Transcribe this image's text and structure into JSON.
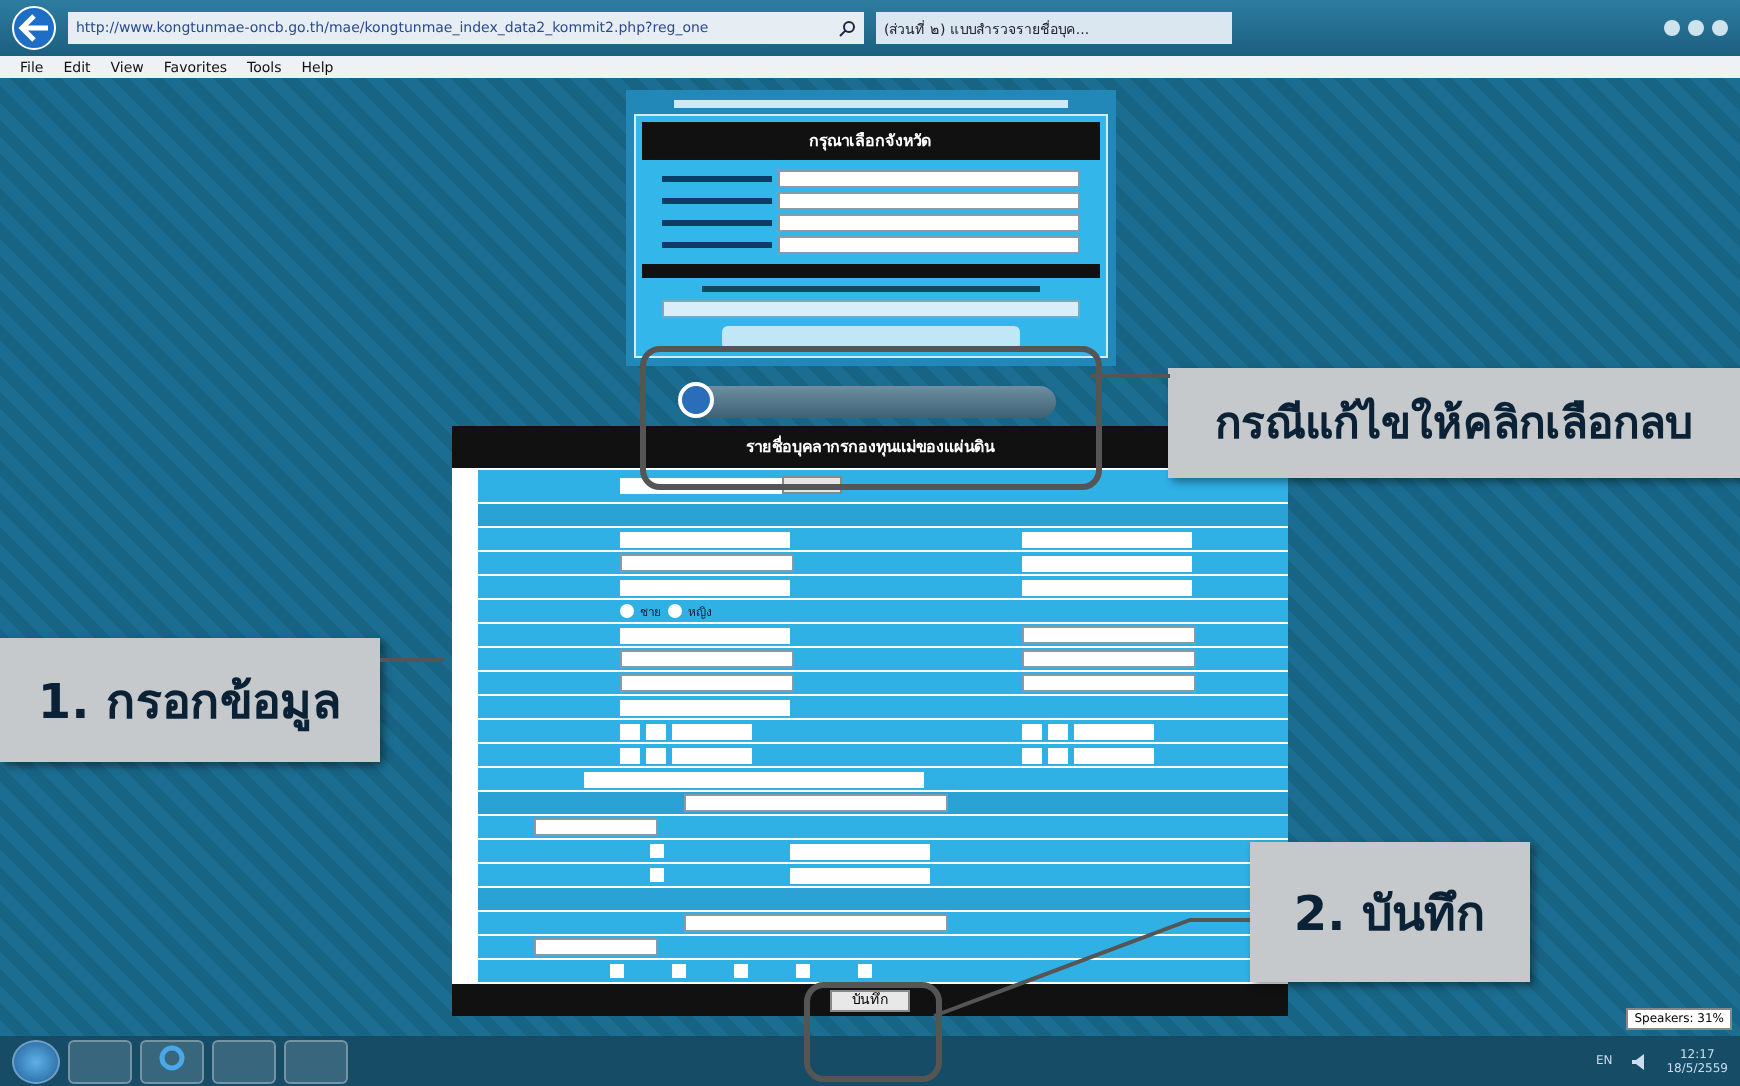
{
  "browser": {
    "url": "http://www.kongtunmae-oncb.go.th/mae/kongtunmae_index_data2_kommit2.php?reg_one",
    "tab_title": "(ส่วนที่ ๒) แบบสำรวจรายชื่อบุค...",
    "menu": [
      "File",
      "Edit",
      "View",
      "Favorites",
      "Tools",
      "Help"
    ]
  },
  "province_panel": {
    "heading": "กรุณาเลือกจังหวัด",
    "selects": [
      {
        "kind": "select"
      },
      {
        "kind": "select"
      },
      {
        "kind": "select"
      },
      {
        "kind": "select"
      }
    ]
  },
  "form": {
    "title": "รายชื่อบุคลากรกองทุนแม่ของแผ่นดิน",
    "save_button": "บันทึก",
    "rows": [
      {
        "kind": "file"
      },
      {
        "kind": "section"
      },
      {
        "kind": "pair",
        "fields": [
          {
            "kind": "input"
          },
          {
            "kind": "input"
          }
        ]
      },
      {
        "kind": "pair",
        "fields": [
          {
            "kind": "select"
          },
          {
            "kind": "input"
          }
        ]
      },
      {
        "kind": "pair",
        "fields": [
          {
            "kind": "input"
          },
          {
            "kind": "input"
          }
        ]
      },
      {
        "kind": "radio",
        "options": [
          {
            "label": "ชาย",
            "selected": false
          },
          {
            "label": "หญิง",
            "selected": false
          }
        ]
      },
      {
        "kind": "pair",
        "fields": [
          {
            "kind": "input"
          },
          {
            "kind": "select"
          }
        ]
      },
      {
        "kind": "pair",
        "fields": [
          {
            "kind": "select"
          },
          {
            "kind": "select"
          }
        ]
      },
      {
        "kind": "pair",
        "fields": [
          {
            "kind": "select"
          },
          {
            "kind": "select"
          }
        ]
      },
      {
        "kind": "pair",
        "fields": [
          {
            "kind": "input"
          }
        ]
      },
      {
        "kind": "dates"
      },
      {
        "kind": "dates"
      },
      {
        "kind": "wide"
      },
      {
        "kind": "section-select"
      },
      {
        "kind": "short-select"
      },
      {
        "kind": "check-input",
        "checks": [
          {
            "checked": false
          }
        ]
      },
      {
        "kind": "check-input",
        "checks": [
          {
            "checked": false
          }
        ]
      },
      {
        "kind": "section"
      },
      {
        "kind": "mid-select"
      },
      {
        "kind": "short-select"
      },
      {
        "kind": "checks",
        "checks": [
          {
            "checked": false
          },
          {
            "checked": false
          },
          {
            "checked": false
          },
          {
            "checked": false
          },
          {
            "checked": false
          }
        ]
      }
    ]
  },
  "callouts": [
    {
      "kind": "edit",
      "text": "กรณีแก้ไขให้คลิกเลือกลบ"
    },
    {
      "kind": "fill",
      "text": "1. กรอกข้อมูล"
    },
    {
      "kind": "save",
      "text": "2. บันทึก"
    }
  ],
  "taskbar": {
    "tooltip": "Speakers: 31%",
    "language": "EN",
    "time": "12:17",
    "date": "18/5/2559"
  }
}
